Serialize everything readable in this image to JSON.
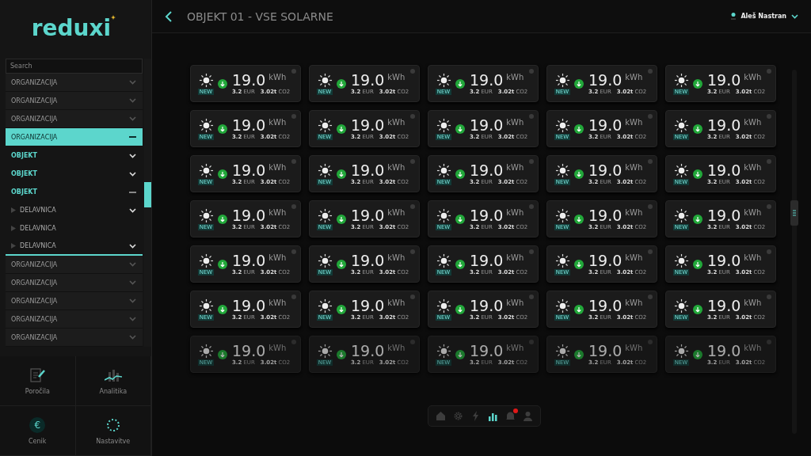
{
  "logo": "reduxi",
  "sidebar": {
    "search": {
      "placeholder": "Search"
    },
    "items": [
      {
        "label": "ORGANIZACIJA",
        "expanded": false,
        "selected": false
      },
      {
        "label": "ORGANIZACIJA",
        "expanded": false,
        "selected": false
      },
      {
        "label": "ORGANIZACIJA",
        "expanded": false,
        "selected": false
      },
      {
        "label": "ORGANIZACIJA",
        "expanded": true,
        "selected": true,
        "children": [
          {
            "label": "OBJEKT",
            "expanded": false
          },
          {
            "label": "OBJEKT",
            "expanded": false
          },
          {
            "label": "OBJEKT",
            "expanded": true,
            "children": [
              {
                "label": "DELAVNICA",
                "expandable": true
              },
              {
                "label": "DELAVNICA",
                "expandable": false
              },
              {
                "label": "DELAVNICA",
                "expandable": true
              }
            ]
          }
        ]
      },
      {
        "label": "ORGANIZACIJA",
        "expanded": false,
        "selected": false
      },
      {
        "label": "ORGANIZACIJA",
        "expanded": false,
        "selected": false
      },
      {
        "label": "ORGANIZACIJA",
        "expanded": false,
        "selected": false
      },
      {
        "label": "ORGANIZACIJA",
        "expanded": false,
        "selected": false
      },
      {
        "label": "ORGANIZACIJA",
        "expanded": false,
        "selected": false
      }
    ],
    "tiles": [
      {
        "kind": "report",
        "label": "Poročila"
      },
      {
        "kind": "analytics",
        "label": "Analitika"
      },
      {
        "kind": "price",
        "icon_text": "€",
        "label": "Cenik"
      },
      {
        "kind": "settings",
        "label": "Nastavitve"
      }
    ]
  },
  "header": {
    "title": "OBJEKT 01 - VSE SOLARNE",
    "user": "Aleš Nastran"
  },
  "card_rows": [
    {
      "dimmed": false,
      "cards": [
        {
          "badge": "NEW",
          "value": "19.0",
          "unit": "kWh",
          "price": "3.2",
          "currency": "EUR",
          "co2_value": "3.02t",
          "co2_label": "CO2"
        },
        {
          "badge": "NEW",
          "value": "19.0",
          "unit": "kWh",
          "price": "3.2",
          "currency": "EUR",
          "co2_value": "3.02t",
          "co2_label": "CO2"
        },
        {
          "badge": "NEW",
          "value": "19.0",
          "unit": "kWh",
          "price": "3.2",
          "currency": "EUR",
          "co2_value": "3.02t",
          "co2_label": "CO2"
        },
        {
          "badge": "NEW",
          "value": "19.0",
          "unit": "kWh",
          "price": "3.2",
          "currency": "EUR",
          "co2_value": "3.02t",
          "co2_label": "CO2"
        },
        {
          "badge": "NEW",
          "value": "19.0",
          "unit": "kWh",
          "price": "3.2",
          "currency": "EUR",
          "co2_value": "3.02t",
          "co2_label": "CO2"
        }
      ]
    },
    {
      "dimmed": false,
      "cards": [
        {
          "badge": "NEW",
          "value": "19.0",
          "unit": "kWh",
          "price": "3.2",
          "currency": "EUR",
          "co2_value": "3.02t",
          "co2_label": "CO2"
        },
        {
          "badge": "NEW",
          "value": "19.0",
          "unit": "kWh",
          "price": "3.2",
          "currency": "EUR",
          "co2_value": "3.02t",
          "co2_label": "CO2"
        },
        {
          "badge": "NEW",
          "value": "19.0",
          "unit": "kWh",
          "price": "3.2",
          "currency": "EUR",
          "co2_value": "3.02t",
          "co2_label": "CO2"
        },
        {
          "badge": "NEW",
          "value": "19.0",
          "unit": "kWh",
          "price": "3.2",
          "currency": "EUR",
          "co2_value": "3.02t",
          "co2_label": "CO2"
        },
        {
          "badge": "NEW",
          "value": "19.0",
          "unit": "kWh",
          "price": "3.2",
          "currency": "EUR",
          "co2_value": "3.02t",
          "co2_label": "CO2"
        }
      ]
    },
    {
      "dimmed": false,
      "cards": [
        {
          "badge": "NEW",
          "value": "19.0",
          "unit": "kWh",
          "price": "3.2",
          "currency": "EUR",
          "co2_value": "3.02t",
          "co2_label": "CO2"
        },
        {
          "badge": "NEW",
          "value": "19.0",
          "unit": "kWh",
          "price": "3.2",
          "currency": "EUR",
          "co2_value": "3.02t",
          "co2_label": "CO2"
        },
        {
          "badge": "NEW",
          "value": "19.0",
          "unit": "kWh",
          "price": "3.2",
          "currency": "EUR",
          "co2_value": "3.02t",
          "co2_label": "CO2"
        },
        {
          "badge": "NEW",
          "value": "19.0",
          "unit": "kWh",
          "price": "3.2",
          "currency": "EUR",
          "co2_value": "3.02t",
          "co2_label": "CO2"
        },
        {
          "badge": "NEW",
          "value": "19.0",
          "unit": "kWh",
          "price": "3.2",
          "currency": "EUR",
          "co2_value": "3.02t",
          "co2_label": "CO2"
        }
      ]
    },
    {
      "dimmed": false,
      "cards": [
        {
          "badge": "NEW",
          "value": "19.0",
          "unit": "kWh",
          "price": "3.2",
          "currency": "EUR",
          "co2_value": "3.02t",
          "co2_label": "CO2"
        },
        {
          "badge": "NEW",
          "value": "19.0",
          "unit": "kWh",
          "price": "3.2",
          "currency": "EUR",
          "co2_value": "3.02t",
          "co2_label": "CO2"
        },
        {
          "badge": "NEW",
          "value": "19.0",
          "unit": "kWh",
          "price": "3.2",
          "currency": "EUR",
          "co2_value": "3.02t",
          "co2_label": "CO2"
        },
        {
          "badge": "NEW",
          "value": "19.0",
          "unit": "kWh",
          "price": "3.2",
          "currency": "EUR",
          "co2_value": "3.02t",
          "co2_label": "CO2"
        },
        {
          "badge": "NEW",
          "value": "19.0",
          "unit": "kWh",
          "price": "3.2",
          "currency": "EUR",
          "co2_value": "3.02t",
          "co2_label": "CO2"
        }
      ]
    },
    {
      "dimmed": false,
      "cards": [
        {
          "badge": "NEW",
          "value": "19.0",
          "unit": "kWh",
          "price": "3.2",
          "currency": "EUR",
          "co2_value": "3.02t",
          "co2_label": "CO2"
        },
        {
          "badge": "NEW",
          "value": "19.0",
          "unit": "kWh",
          "price": "3.2",
          "currency": "EUR",
          "co2_value": "3.02t",
          "co2_label": "CO2"
        },
        {
          "badge": "NEW",
          "value": "19.0",
          "unit": "kWh",
          "price": "3.2",
          "currency": "EUR",
          "co2_value": "3.02t",
          "co2_label": "CO2"
        },
        {
          "badge": "NEW",
          "value": "19.0",
          "unit": "kWh",
          "price": "3.2",
          "currency": "EUR",
          "co2_value": "3.02t",
          "co2_label": "CO2"
        },
        {
          "badge": "NEW",
          "value": "19.0",
          "unit": "kWh",
          "price": "3.2",
          "currency": "EUR",
          "co2_value": "3.02t",
          "co2_label": "CO2"
        }
      ]
    },
    {
      "dimmed": false,
      "cards": [
        {
          "badge": "NEW",
          "value": "19.0",
          "unit": "kWh",
          "price": "3.2",
          "currency": "EUR",
          "co2_value": "3.02t",
          "co2_label": "CO2"
        },
        {
          "badge": "NEW",
          "value": "19.0",
          "unit": "kWh",
          "price": "3.2",
          "currency": "EUR",
          "co2_value": "3.02t",
          "co2_label": "CO2"
        },
        {
          "badge": "NEW",
          "value": "19.0",
          "unit": "kWh",
          "price": "3.2",
          "currency": "EUR",
          "co2_value": "3.02t",
          "co2_label": "CO2"
        },
        {
          "badge": "NEW",
          "value": "19.0",
          "unit": "kWh",
          "price": "3.2",
          "currency": "EUR",
          "co2_value": "3.02t",
          "co2_label": "CO2"
        },
        {
          "badge": "NEW",
          "value": "19.0",
          "unit": "kWh",
          "price": "3.2",
          "currency": "EUR",
          "co2_value": "3.02t",
          "co2_label": "CO2"
        }
      ]
    },
    {
      "dimmed": true,
      "cards": [
        {
          "badge": "NEW",
          "value": "19.0",
          "unit": "kWh",
          "price": "3.2",
          "currency": "EUR",
          "co2_value": "3.02t",
          "co2_label": "CO2"
        },
        {
          "badge": "NEW",
          "value": "19.0",
          "unit": "kWh",
          "price": "3.2",
          "currency": "EUR",
          "co2_value": "3.02t",
          "co2_label": "CO2"
        },
        {
          "badge": "NEW",
          "value": "19.0",
          "unit": "kWh",
          "price": "3.2",
          "currency": "EUR",
          "co2_value": "3.02t",
          "co2_label": "CO2"
        },
        {
          "badge": "NEW",
          "value": "19.0",
          "unit": "kWh",
          "price": "3.2",
          "currency": "EUR",
          "co2_value": "3.02t",
          "co2_label": "CO2"
        },
        {
          "badge": "NEW",
          "value": "19.0",
          "unit": "kWh",
          "price": "3.2",
          "currency": "EUR",
          "co2_value": "3.02t",
          "co2_label": "CO2"
        }
      ]
    }
  ],
  "bottom_nav": [
    {
      "kind": "home",
      "selected": false
    },
    {
      "kind": "settings",
      "selected": false
    },
    {
      "kind": "bolt",
      "selected": false
    },
    {
      "kind": "chart",
      "selected": true
    },
    {
      "kind": "bell",
      "selected": false,
      "alert": true
    },
    {
      "kind": "user",
      "selected": false
    }
  ]
}
